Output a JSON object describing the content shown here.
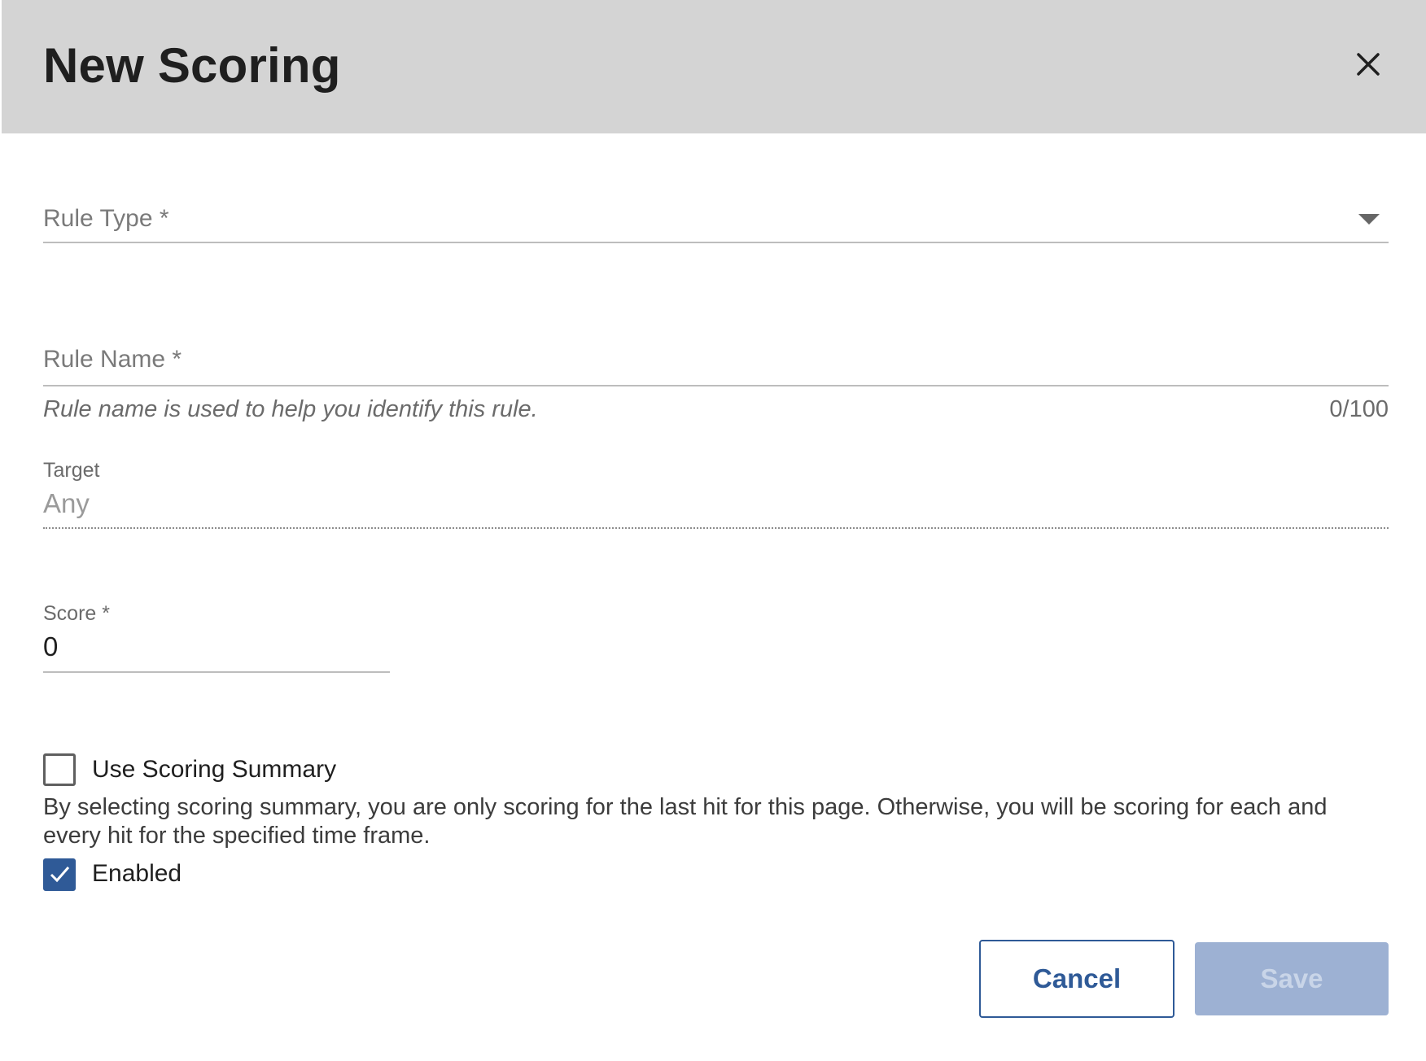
{
  "dialog": {
    "title": "New Scoring",
    "close_icon": "close-icon"
  },
  "form": {
    "rule_type": {
      "label": "Rule Type *",
      "icon": "dropdown-arrow-icon"
    },
    "rule_name": {
      "label": "Rule Name *",
      "helper": "Rule name is used to help you identify this rule.",
      "counter": "0/100"
    },
    "target": {
      "label": "Target",
      "value": "Any"
    },
    "score": {
      "label": "Score *",
      "value": "0"
    },
    "use_scoring_summary": {
      "label": "Use Scoring Summary",
      "checked": false,
      "description": "By selecting scoring summary, you are only scoring for the last hit for this page. Otherwise, you will be scoring for each and every hit for the specified time frame."
    },
    "enabled": {
      "label": "Enabled",
      "checked": true,
      "icon": "checkmark-icon"
    }
  },
  "actions": {
    "cancel_label": "Cancel",
    "save_label": "Save"
  },
  "colors": {
    "header_bg": "#d4d4d4",
    "primary": "#2f5a97",
    "disabled_button": "#9db1d3"
  }
}
